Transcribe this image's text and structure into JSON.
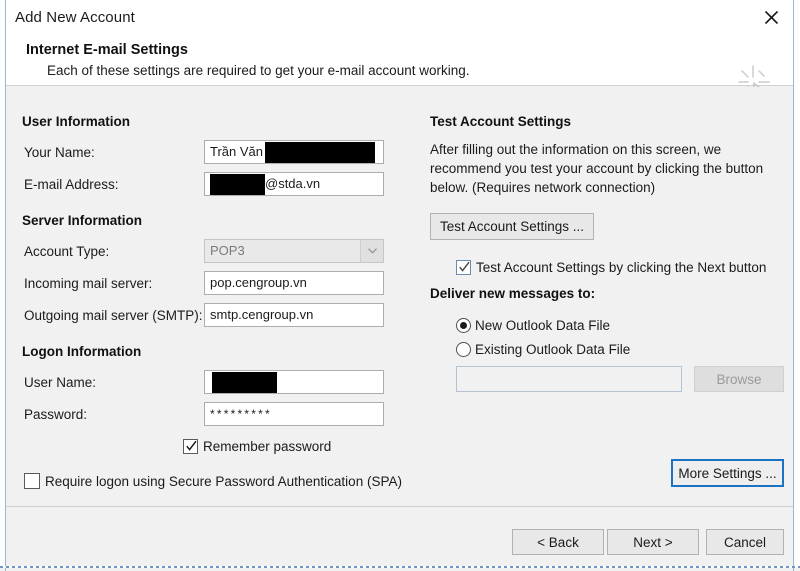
{
  "window": {
    "title": "Add New Account",
    "close_label": "close-icon",
    "accent_focus_color": "#1b73c4",
    "border_color": "#9fb6cd"
  },
  "header": {
    "title": "Internet E-mail Settings",
    "subtitle": "Each of these settings are required to get your e-mail account working.",
    "watermark_icon": "sparkle-cursor-icon"
  },
  "left_column": {
    "user_information": {
      "group_title": "User Information",
      "fields": [
        {
          "label": "Your Name:",
          "value": "Trần Văn",
          "redacted": true,
          "redaction_width": 110
        },
        {
          "label": "E-mail Address:",
          "value": "@stda.vn",
          "redacted": true,
          "redaction_width": 55
        }
      ]
    },
    "server_information": {
      "group_title": "Server Information",
      "account_type": {
        "label": "Account Type:",
        "value": "POP3",
        "disabled": true,
        "dropdown_icon": "chevron-down-icon"
      },
      "incoming": {
        "label": "Incoming mail server:",
        "value": "pop.cengroup.vn"
      },
      "outgoing": {
        "label": "Outgoing mail server (SMTP):",
        "value": "smtp.cengroup.vn"
      }
    },
    "logon_information": {
      "group_title": "Logon Information",
      "user_name": {
        "label": "User Name:",
        "value": "",
        "redacted": true,
        "redaction_width": 65
      },
      "password": {
        "label": "Password:",
        "value": "*********"
      },
      "remember_password": {
        "label": "Remember password",
        "checked": true
      },
      "require_spa": {
        "label": "Require logon using Secure Password Authentication (SPA)",
        "checked": false
      }
    }
  },
  "right_column": {
    "test_account": {
      "group_title": "Test Account Settings",
      "description": "After filling out the information on this screen, we recommend you test your account by clicking the button below. (Requires network connection)",
      "test_button_label": "Test Account Settings ...",
      "test_on_next": {
        "label": "Test Account Settings by clicking the Next button",
        "checked": true
      }
    },
    "deliver": {
      "group_title": "Deliver new messages to:",
      "options": [
        {
          "label": "New Outlook Data File",
          "selected": true
        },
        {
          "label": "Existing Outlook Data File",
          "selected": false
        }
      ],
      "data_file_path": {
        "value": "",
        "placeholder": "",
        "disabled": true
      },
      "browse_button": {
        "label": "Browse",
        "disabled": true
      }
    },
    "more_settings_button": {
      "label": "More Settings ...",
      "focused": true
    }
  },
  "footer": {
    "buttons": [
      {
        "label": "< Back"
      },
      {
        "label": "Next >"
      },
      {
        "label": "Cancel"
      }
    ]
  }
}
